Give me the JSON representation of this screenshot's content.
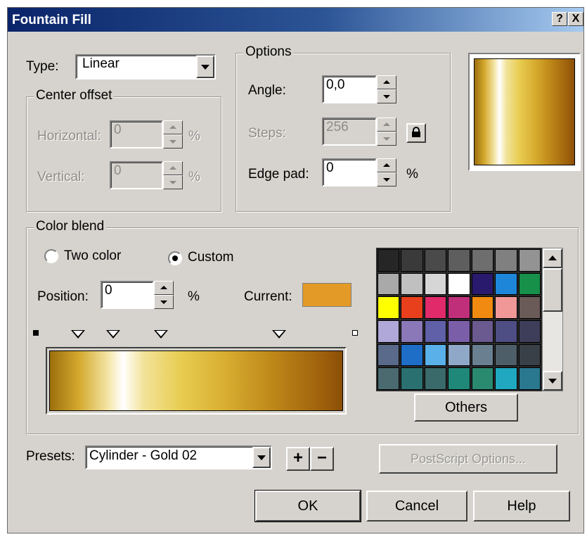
{
  "title": "Fountain Fill",
  "title_buttons": {
    "help": "?",
    "close": "X"
  },
  "type": {
    "label": "Type:",
    "value": "Linear"
  },
  "center_offset": {
    "title": "Center offset",
    "horizontal_label": "Horizontal:",
    "horizontal_value": "0",
    "vertical_label": "Vertical:",
    "vertical_value": "0",
    "unit": "%"
  },
  "options": {
    "title": "Options",
    "angle_label": "Angle:",
    "angle_value": "0,0",
    "steps_label": "Steps:",
    "steps_value": "256",
    "edge_pad_label": "Edge pad:",
    "edge_pad_value": "0",
    "unit": "%"
  },
  "color_blend": {
    "title": "Color blend",
    "two_color_label": "Two color",
    "custom_label": "Custom",
    "selected_mode": "custom",
    "position_label": "Position:",
    "position_value": "0",
    "unit": "%",
    "current_label": "Current:",
    "current_color": "#e39a26",
    "marker_positions": [
      0.1,
      0.22,
      0.38,
      0.78
    ]
  },
  "palette": {
    "colors": [
      "#262626",
      "#3a3a3a",
      "#4a4a4a",
      "#5e5e5e",
      "#6e6e6e",
      "#808080",
      "#939393",
      "#a9a9a9",
      "#c0c0c0",
      "#d6d6d6",
      "#ffffff",
      "#2a1a6e",
      "#1e86d8",
      "#17904a",
      "#ffff00",
      "#e8401c",
      "#e02a6a",
      "#c0307a",
      "#f08a10",
      "#f09898",
      "#6a5a58",
      "#b0a8d8",
      "#8a78b8",
      "#6060a8",
      "#7a5ea8",
      "#6a5a90",
      "#4e4e84",
      "#3e3e5a",
      "#5a6a8a",
      "#1e6ec8",
      "#5ab0e8",
      "#90a8c8",
      "#6a8090",
      "#4e5e68",
      "#3a4048",
      "#4a6a70",
      "#2a7070",
      "#3a6a6a",
      "#208878",
      "#2a8a70",
      "#20a8c0",
      "#2a7890"
    ]
  },
  "others_button": "Others",
  "presets": {
    "label": "Presets:",
    "value": "Cylinder - Gold 02",
    "add": "+",
    "remove": "−"
  },
  "postscript_button": "PostScript Options...",
  "buttons": {
    "ok": "OK",
    "cancel": "Cancel",
    "help": "Help"
  }
}
